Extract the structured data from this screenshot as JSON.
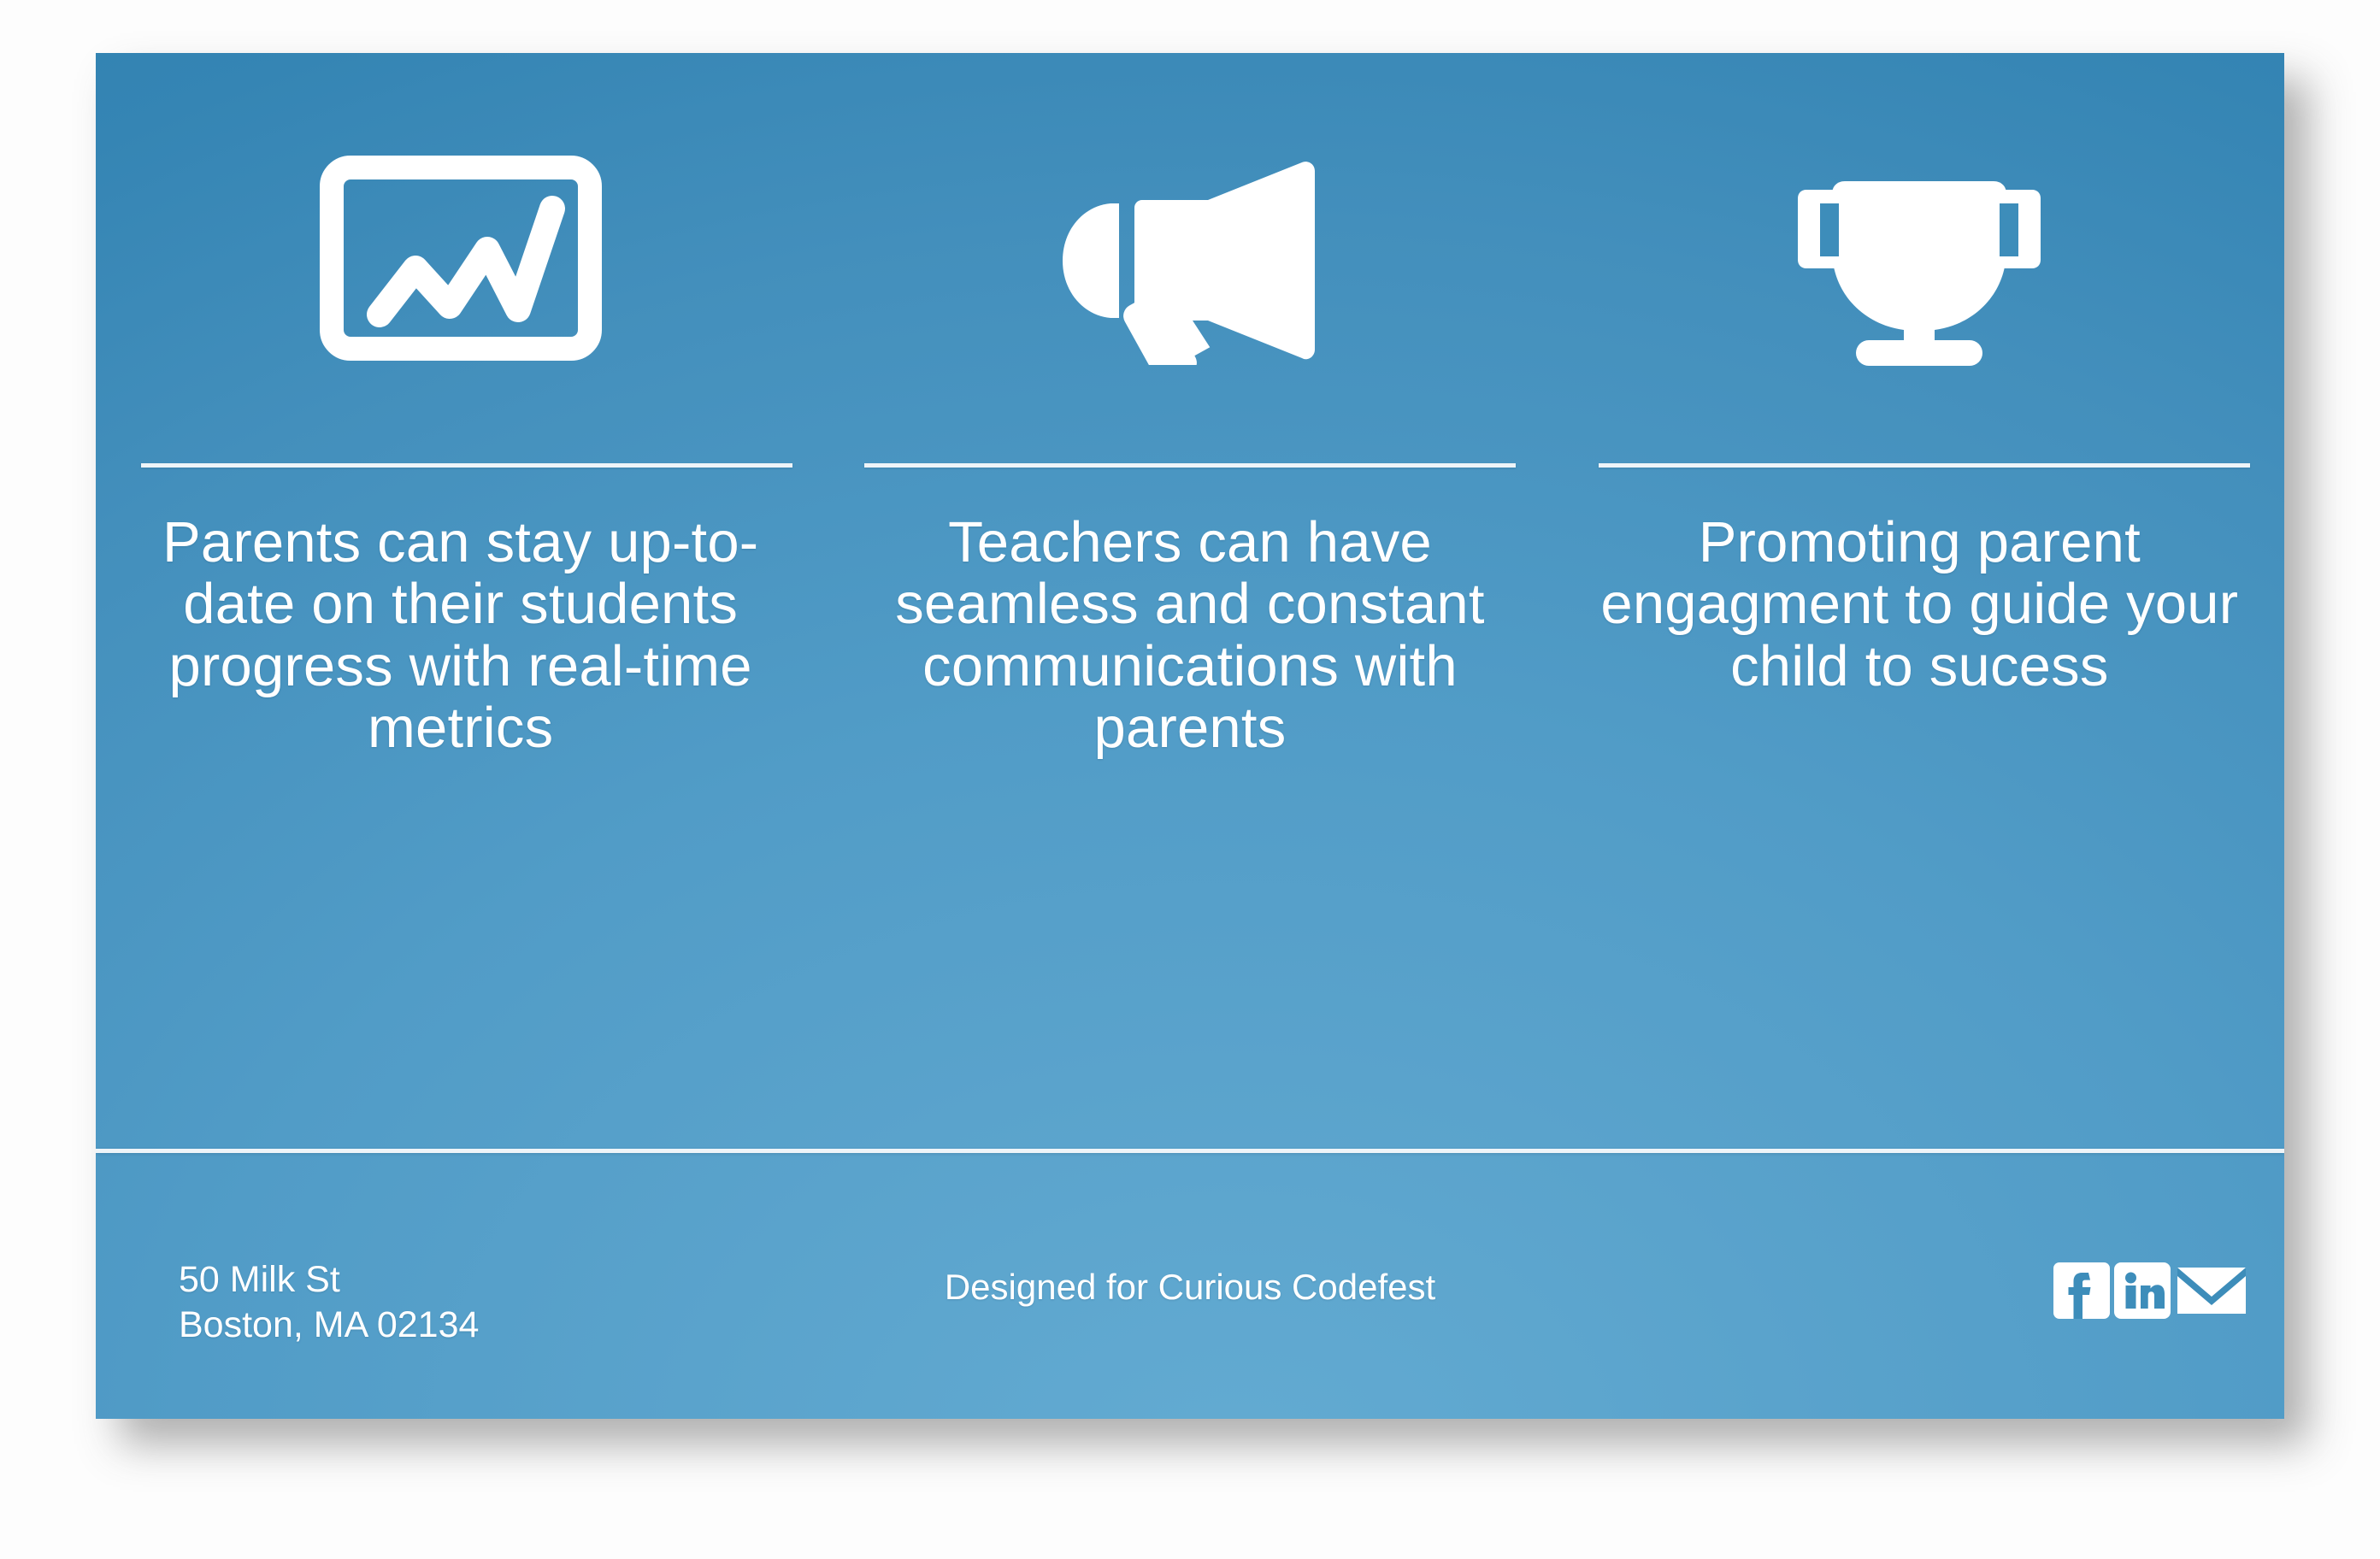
{
  "card": {
    "background_start": "#63abd2",
    "background_end": "#2e80af",
    "text_color": "#ffffff",
    "divider_color": "#eef4f8"
  },
  "columns": [
    {
      "icon": "line-chart-monitor-icon",
      "text": "Parents can stay up-to-date on their students progress with real-time metrics"
    },
    {
      "icon": "megaphone-icon",
      "text": "Teachers can have seamless and constant communications with parents"
    },
    {
      "icon": "trophy-icon",
      "text": "Promoting parent engagment to guide your child to sucess"
    }
  ],
  "footer": {
    "address_line1": "50 Milk St",
    "address_line2": "Boston, MA 02134",
    "credit": "Designed for Curious Codefest",
    "social": [
      {
        "name": "facebook-icon",
        "label": "f"
      },
      {
        "name": "linkedin-icon",
        "label": "in"
      },
      {
        "name": "email-icon",
        "label": "envelope"
      }
    ]
  }
}
